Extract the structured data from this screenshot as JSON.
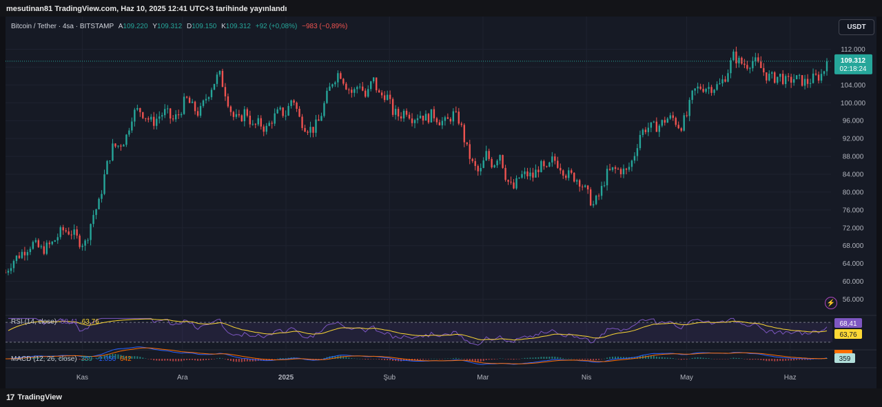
{
  "header": {
    "text": "mesutinan81 TradingView.com, Haz 10, 2025 12:41 UTC+3 tarihinde yayınlandı"
  },
  "legend": {
    "symbol": "Bitcoin / Tether · 4sa · BITSTAMP",
    "open_label": "A",
    "open": "109.220",
    "high_label": "Y",
    "high": "109.312",
    "low_label": "D",
    "low": "109.150",
    "close_label": "K",
    "close": "109.312",
    "change": "+92 (+0,08%)",
    "change2": "−983 (−0,89%)"
  },
  "currency_button": "USDT",
  "price_badge": {
    "price": "109.312",
    "countdown": "02:18:24"
  },
  "rsi": {
    "label": "RSI (14, close)",
    "value_rsi": "68,41",
    "value_ma": "63,76"
  },
  "macd": {
    "label": "MACD (12, 26, close)",
    "v1": "359",
    "v2": "-1.056",
    "v3": "642",
    "badge": "359"
  },
  "footer": {
    "logo": "TradingView",
    "logo_mark": "17"
  },
  "colors": {
    "up": "#26a69a",
    "down": "#ef5350",
    "rsi": "#7e57c2",
    "rsi_ma": "#fdd835",
    "macd": "#2962ff",
    "signal": "#ff6d00"
  },
  "chart_data": {
    "type": "candlestick",
    "symbol": "Bitcoin / Tether",
    "interval": "4sa",
    "y_ticks": [
      "112.000",
      "108.000",
      "104.000",
      "100.000",
      "96.000",
      "92.000",
      "88.000",
      "84.000",
      "80.000",
      "76.000",
      "72.000",
      "68.000",
      "64.000",
      "60.000",
      "56.000"
    ],
    "ylim": [
      53000,
      115000
    ],
    "x_labels": [
      {
        "label": "Kas",
        "day": 28
      },
      {
        "label": "Ara",
        "day": 58
      },
      {
        "label": "2025",
        "day": 89
      },
      {
        "label": "Şub",
        "day": 120
      },
      {
        "label": "Mar",
        "day": 148
      },
      {
        "label": "Nis",
        "day": 179
      },
      {
        "label": "May",
        "day": 209
      },
      {
        "label": "Haz",
        "day": 240
      }
    ],
    "x_range_days": [
      5,
      251
    ],
    "last_price": 109312,
    "close_path": [
      {
        "day": 5,
        "price": 62000
      },
      {
        "day": 7,
        "price": 64500
      },
      {
        "day": 10,
        "price": 66500
      },
      {
        "day": 13,
        "price": 68500
      },
      {
        "day": 16,
        "price": 67000
      },
      {
        "day": 19,
        "price": 68500
      },
      {
        "day": 22,
        "price": 71500
      },
      {
        "day": 25,
        "price": 71000
      },
      {
        "day": 27,
        "price": 69000
      },
      {
        "day": 29,
        "price": 68500
      },
      {
        "day": 31,
        "price": 74500
      },
      {
        "day": 33,
        "price": 77500
      },
      {
        "day": 35,
        "price": 85000
      },
      {
        "day": 37,
        "price": 90000
      },
      {
        "day": 39,
        "price": 90500
      },
      {
        "day": 41,
        "price": 92000
      },
      {
        "day": 43,
        "price": 97500
      },
      {
        "day": 45,
        "price": 98500
      },
      {
        "day": 47,
        "price": 97000
      },
      {
        "day": 49,
        "price": 95500
      },
      {
        "day": 51,
        "price": 97000
      },
      {
        "day": 53,
        "price": 98000
      },
      {
        "day": 55,
        "price": 96000
      },
      {
        "day": 57,
        "price": 97500
      },
      {
        "day": 59,
        "price": 101000
      },
      {
        "day": 61,
        "price": 99000
      },
      {
        "day": 63,
        "price": 97500
      },
      {
        "day": 65,
        "price": 101000
      },
      {
        "day": 67,
        "price": 104000
      },
      {
        "day": 69,
        "price": 106500
      },
      {
        "day": 71,
        "price": 102000
      },
      {
        "day": 73,
        "price": 97000
      },
      {
        "day": 75,
        "price": 96000
      },
      {
        "day": 77,
        "price": 98500
      },
      {
        "day": 79,
        "price": 94500
      },
      {
        "day": 81,
        "price": 95500
      },
      {
        "day": 83,
        "price": 94000
      },
      {
        "day": 85,
        "price": 96500
      },
      {
        "day": 87,
        "price": 98000
      },
      {
        "day": 89,
        "price": 97500
      },
      {
        "day": 91,
        "price": 101500
      },
      {
        "day": 93,
        "price": 96500
      },
      {
        "day": 95,
        "price": 94500
      },
      {
        "day": 97,
        "price": 94000
      },
      {
        "day": 99,
        "price": 96000
      },
      {
        "day": 101,
        "price": 101000
      },
      {
        "day": 103,
        "price": 105000
      },
      {
        "day": 105,
        "price": 107000
      },
      {
        "day": 107,
        "price": 104000
      },
      {
        "day": 109,
        "price": 102000
      },
      {
        "day": 111,
        "price": 104500
      },
      {
        "day": 113,
        "price": 101000
      },
      {
        "day": 115,
        "price": 105500
      },
      {
        "day": 117,
        "price": 101500
      },
      {
        "day": 119,
        "price": 102000
      },
      {
        "day": 121,
        "price": 98000
      },
      {
        "day": 123,
        "price": 97000
      },
      {
        "day": 125,
        "price": 98500
      },
      {
        "day": 127,
        "price": 96500
      },
      {
        "day": 129,
        "price": 97500
      },
      {
        "day": 131,
        "price": 96500
      },
      {
        "day": 133,
        "price": 97500
      },
      {
        "day": 135,
        "price": 96000
      },
      {
        "day": 137,
        "price": 95500
      },
      {
        "day": 139,
        "price": 97500
      },
      {
        "day": 141,
        "price": 96000
      },
      {
        "day": 143,
        "price": 90000
      },
      {
        "day": 145,
        "price": 86000
      },
      {
        "day": 147,
        "price": 84000
      },
      {
        "day": 149,
        "price": 88500
      },
      {
        "day": 151,
        "price": 86000
      },
      {
        "day": 153,
        "price": 89000
      },
      {
        "day": 155,
        "price": 83000
      },
      {
        "day": 157,
        "price": 80500
      },
      {
        "day": 159,
        "price": 83500
      },
      {
        "day": 161,
        "price": 84000
      },
      {
        "day": 163,
        "price": 83500
      },
      {
        "day": 165,
        "price": 86000
      },
      {
        "day": 167,
        "price": 84500
      },
      {
        "day": 169,
        "price": 87500
      },
      {
        "day": 171,
        "price": 86000
      },
      {
        "day": 173,
        "price": 84000
      },
      {
        "day": 175,
        "price": 83500
      },
      {
        "day": 177,
        "price": 82500
      },
      {
        "day": 179,
        "price": 80000
      },
      {
        "day": 181,
        "price": 77000
      },
      {
        "day": 183,
        "price": 79500
      },
      {
        "day": 185,
        "price": 84000
      },
      {
        "day": 187,
        "price": 85000
      },
      {
        "day": 189,
        "price": 85000
      },
      {
        "day": 191,
        "price": 84500
      },
      {
        "day": 193,
        "price": 87500
      },
      {
        "day": 195,
        "price": 93000
      },
      {
        "day": 197,
        "price": 94500
      },
      {
        "day": 199,
        "price": 94500
      },
      {
        "day": 201,
        "price": 95000
      },
      {
        "day": 203,
        "price": 96500
      },
      {
        "day": 205,
        "price": 96500
      },
      {
        "day": 207,
        "price": 94500
      },
      {
        "day": 209,
        "price": 97000
      },
      {
        "day": 211,
        "price": 102500
      },
      {
        "day": 213,
        "price": 103500
      },
      {
        "day": 215,
        "price": 103500
      },
      {
        "day": 217,
        "price": 103500
      },
      {
        "day": 219,
        "price": 104000
      },
      {
        "day": 221,
        "price": 106500
      },
      {
        "day": 223,
        "price": 110500
      },
      {
        "day": 225,
        "price": 109000
      },
      {
        "day": 227,
        "price": 108500
      },
      {
        "day": 229,
        "price": 109500
      },
      {
        "day": 231,
        "price": 108000
      },
      {
        "day": 233,
        "price": 106000
      },
      {
        "day": 235,
        "price": 105500
      },
      {
        "day": 237,
        "price": 106000
      },
      {
        "day": 239,
        "price": 104500
      },
      {
        "day": 241,
        "price": 105500
      },
      {
        "day": 243,
        "price": 105000
      },
      {
        "day": 245,
        "price": 104500
      },
      {
        "day": 247,
        "price": 105500
      },
      {
        "day": 249,
        "price": 106000
      },
      {
        "day": 250,
        "price": 107000
      },
      {
        "day": 251,
        "price": 109312
      }
    ]
  }
}
